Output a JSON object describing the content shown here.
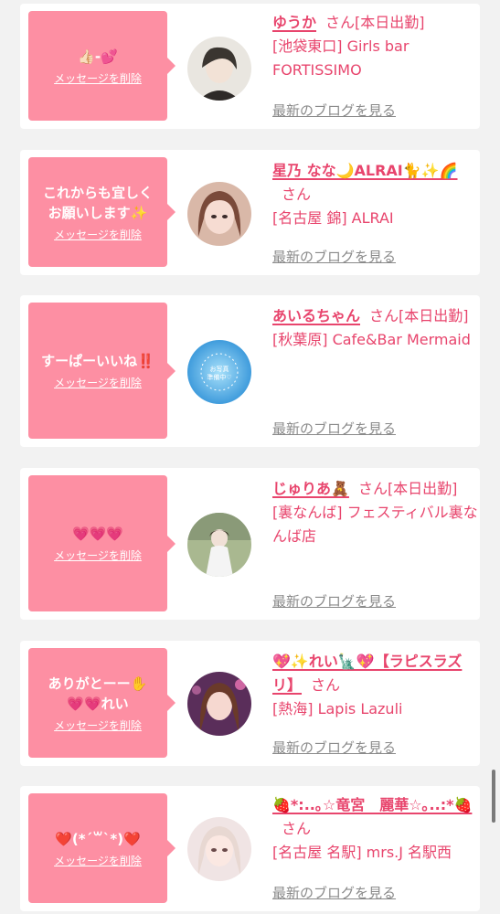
{
  "cards": [
    {
      "message": "👍🏻-💕",
      "delete_label": "メッセージを削除",
      "name": "ゆうか",
      "san": "さん[本日出勤]",
      "shop": "[池袋東口] Girls bar FORTISSIMO",
      "blog_label": "最新のブログを見る",
      "avatar_colors": [
        "#e9e6e0",
        "#3a3530"
      ]
    },
    {
      "message": "これからも宜しく\nお願いします✨",
      "delete_label": "メッセージを削除",
      "name": "星乃 なな🌙ALRAI🐈✨🌈",
      "san": "さん",
      "shop": "[名古屋 錦] ALRAI",
      "blog_label": "最新のブログを見る",
      "avatar_colors": [
        "#e8c8c0",
        "#7a4a3a"
      ]
    },
    {
      "message": "すーぱーいいね‼️",
      "delete_label": "メッセージを削除",
      "name": "あいるちゃん",
      "san": "さん[本日出勤]",
      "shop": "[秋葉原] Cafe&Bar Mermaid",
      "blog_label": "最新のブログを見る",
      "avatar_colors": [
        "#6fc8f2",
        "#2a8ed6"
      ],
      "avatar_text": "お写真\n準備中♡"
    },
    {
      "message": "💗💗💗",
      "delete_label": "メッセージを削除",
      "name": "じゅりあ🧸",
      "san": "さん[本日出勤]",
      "shop": "[裏なんば] フェスティバル裏なんば店",
      "blog_label": "最新のブログを見る",
      "avatar_colors": [
        "#bfc9a8",
        "#5a5048"
      ]
    },
    {
      "message": "ありがとーー✋\n💗💗れい",
      "delete_label": "メッセージを削除",
      "name": "💖✨れい🗽💖【ラピスラズリ】",
      "san": "さん",
      "shop": "[熱海] Lapis Lazuli",
      "blog_label": "最新のブログを見る",
      "avatar_colors": [
        "#c870a8",
        "#3a2040"
      ]
    },
    {
      "message": "❤️(*´꒳`*)❤️",
      "delete_label": "メッセージを削除",
      "name": "🍓*:..｡☆竜宮　麗華☆｡..:*🍓",
      "san": "さん",
      "shop": "[名古屋 名駅] mrs.J 名駅西",
      "blog_label": "最新のブログを見る",
      "avatar_colors": [
        "#f0e4e4",
        "#b89a9a"
      ]
    }
  ]
}
